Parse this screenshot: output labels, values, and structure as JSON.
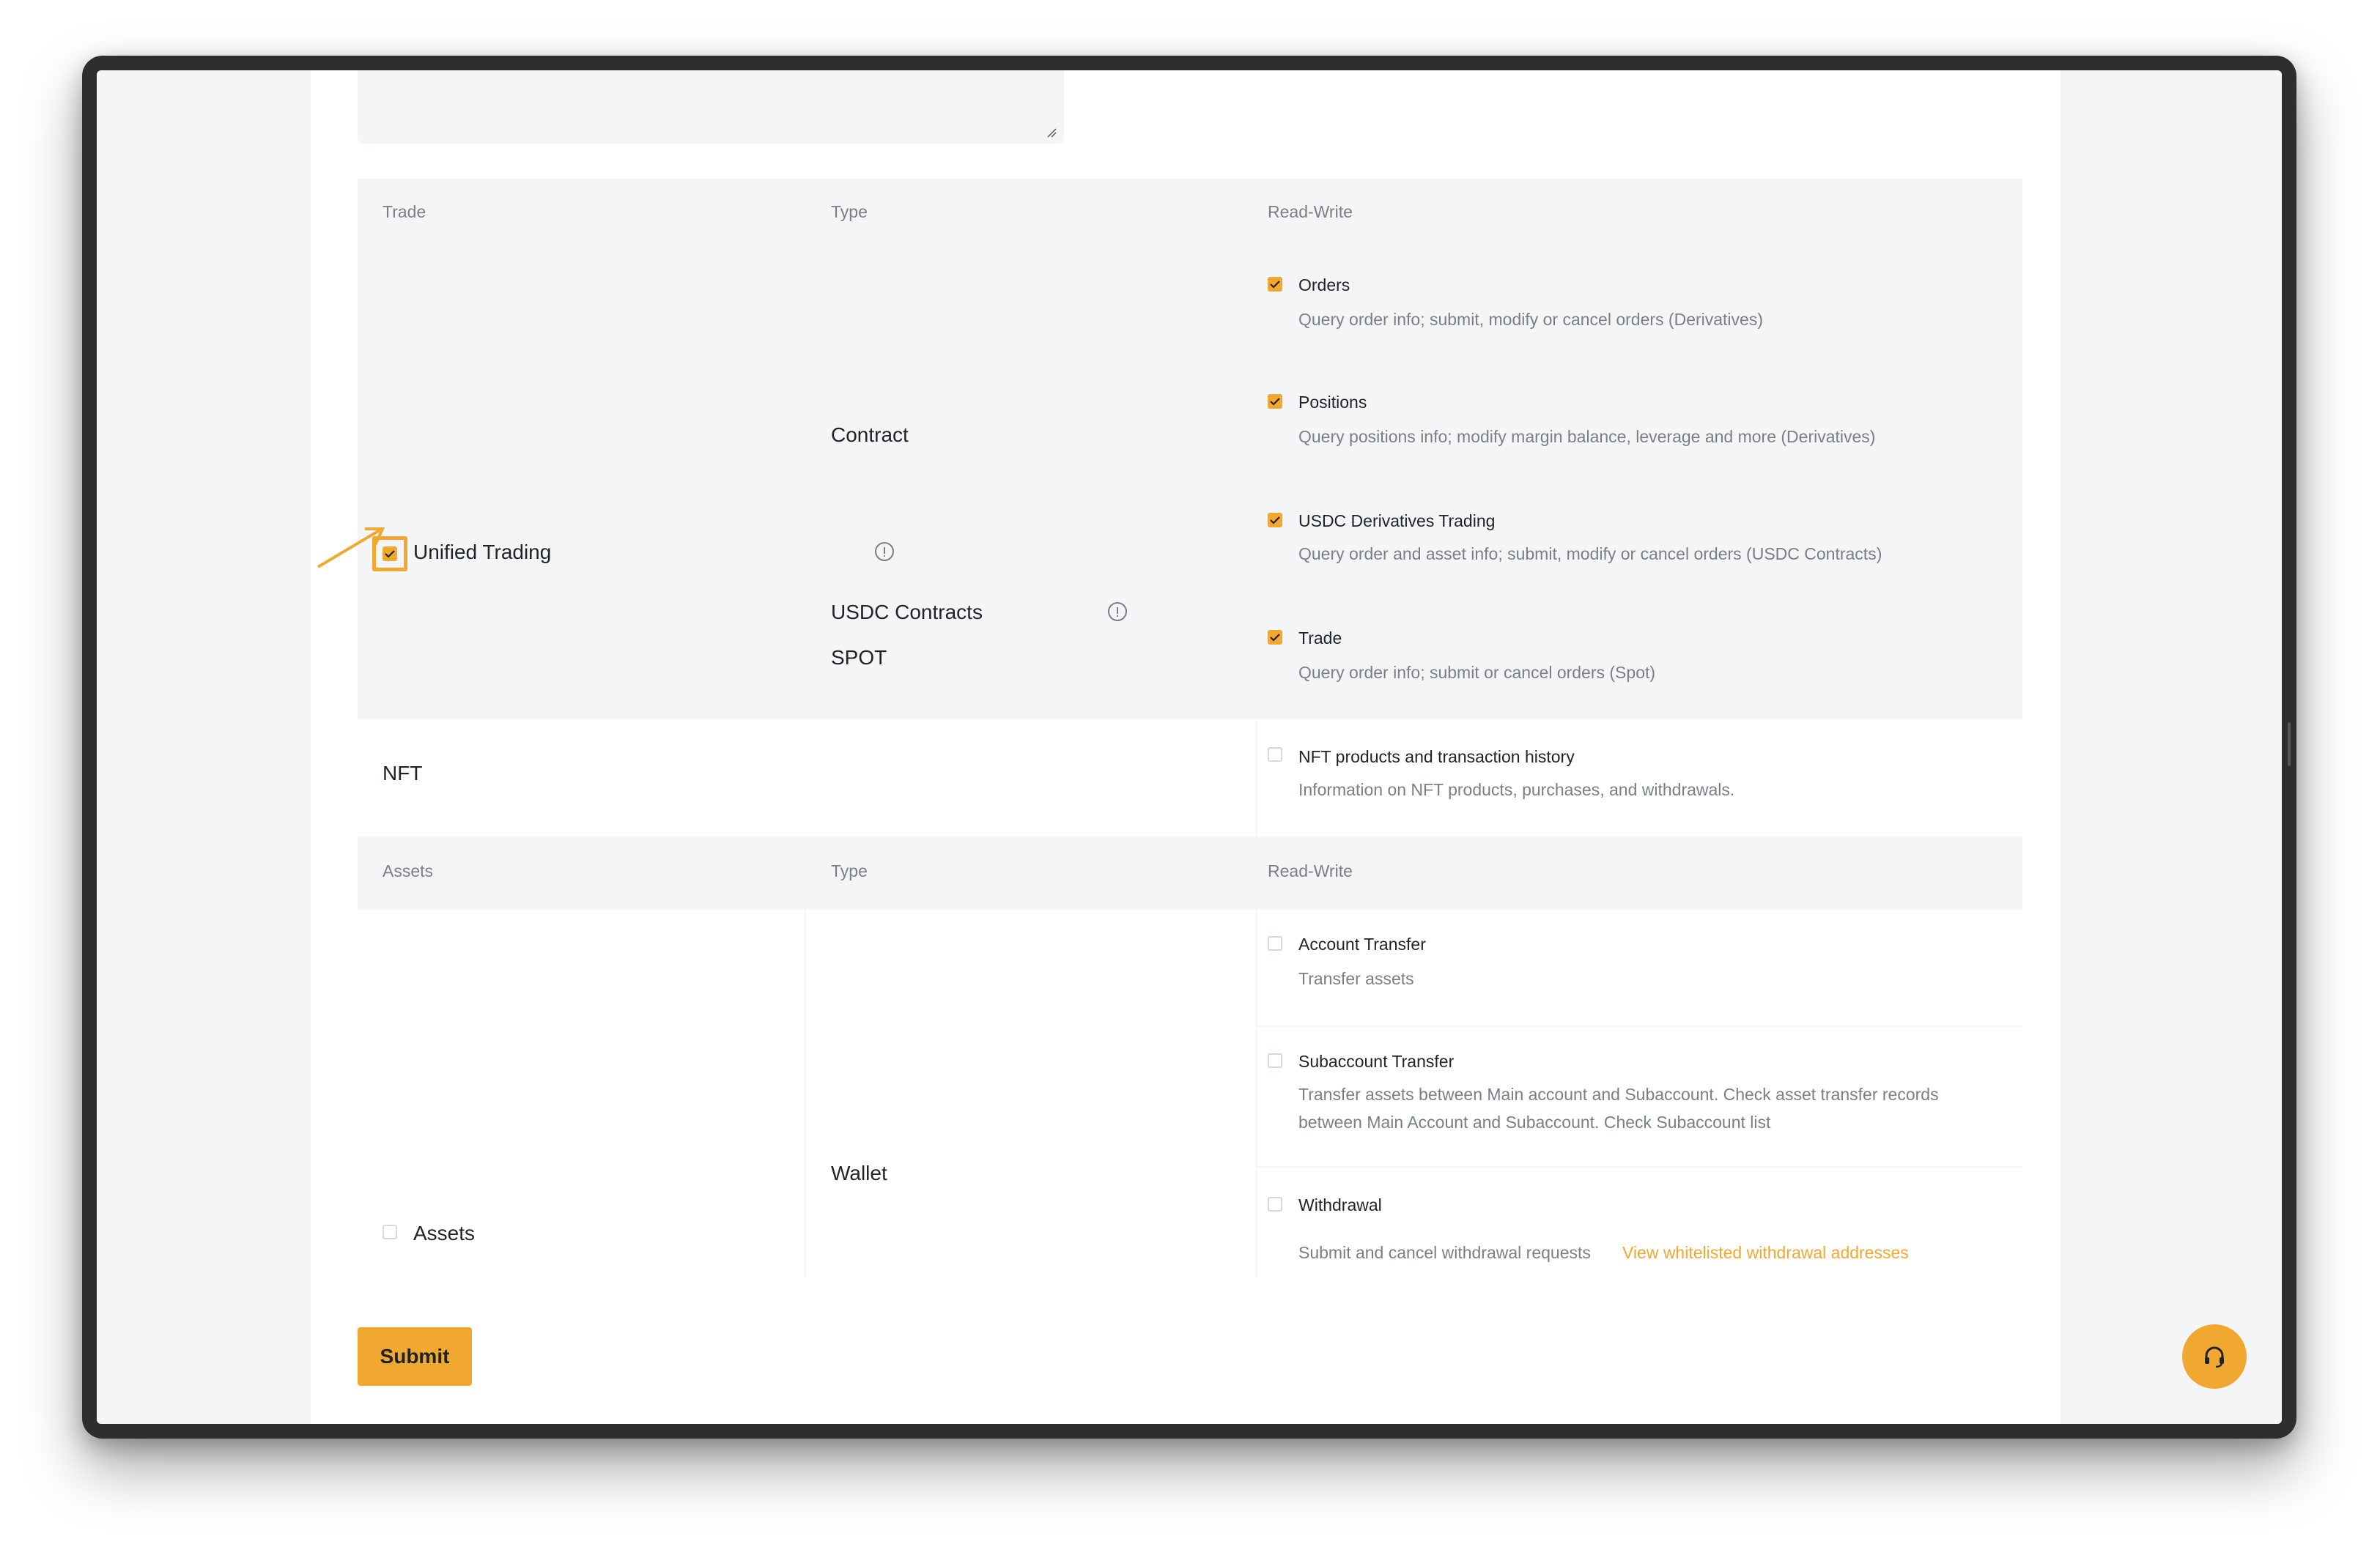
{
  "trade_section": {
    "header": {
      "col1": "Trade",
      "col2": "Type",
      "col3": "Read-Write"
    },
    "unified": {
      "label": "Unified Trading",
      "checked": true
    },
    "types": {
      "contract": "Contract",
      "usdc": "USDC Contracts",
      "spot": "SPOT"
    },
    "permissions": [
      {
        "title": "Orders",
        "desc": "Query order info; submit, modify or cancel orders (Derivatives)",
        "checked": true
      },
      {
        "title": "Positions",
        "desc": "Query positions info; modify margin balance, leverage and more (Derivatives)",
        "checked": true
      },
      {
        "title": "USDC Derivatives Trading",
        "desc": "Query order and asset info; submit, modify or cancel orders (USDC Contracts)",
        "checked": true
      },
      {
        "title": "Trade",
        "desc": "Query order info; submit or cancel orders (Spot)",
        "checked": true
      }
    ]
  },
  "nft_section": {
    "label": "NFT",
    "permission": {
      "title": "NFT products and transaction history",
      "desc": "Information on NFT products, purchases, and withdrawals.",
      "checked": false
    }
  },
  "assets_section": {
    "header": {
      "col1": "Assets",
      "col2": "Type",
      "col3": "Read-Write"
    },
    "assets": {
      "label": "Assets",
      "checked": false
    },
    "type": "Wallet",
    "permissions": [
      {
        "title": "Account Transfer",
        "desc": "Transfer assets",
        "checked": false
      },
      {
        "title": "Subaccount Transfer",
        "desc_line1": "Transfer assets between Main account and Subaccount. Check asset transfer records",
        "desc_line2": "between Main Account and Subaccount. Check Subaccount list",
        "checked": false
      },
      {
        "title": "Withdrawal",
        "desc": "Submit and cancel withdrawal requests",
        "link": "View whitelisted withdrawal addresses",
        "checked": false
      }
    ]
  },
  "submit_label": "Submit",
  "colors": {
    "accent": "#f0a830",
    "panel": "#f4f5f7",
    "text": "#1e2329",
    "muted": "#7a7f87"
  },
  "icons": {
    "support": "headset-icon",
    "info": "info-icon",
    "check": "check-icon"
  }
}
